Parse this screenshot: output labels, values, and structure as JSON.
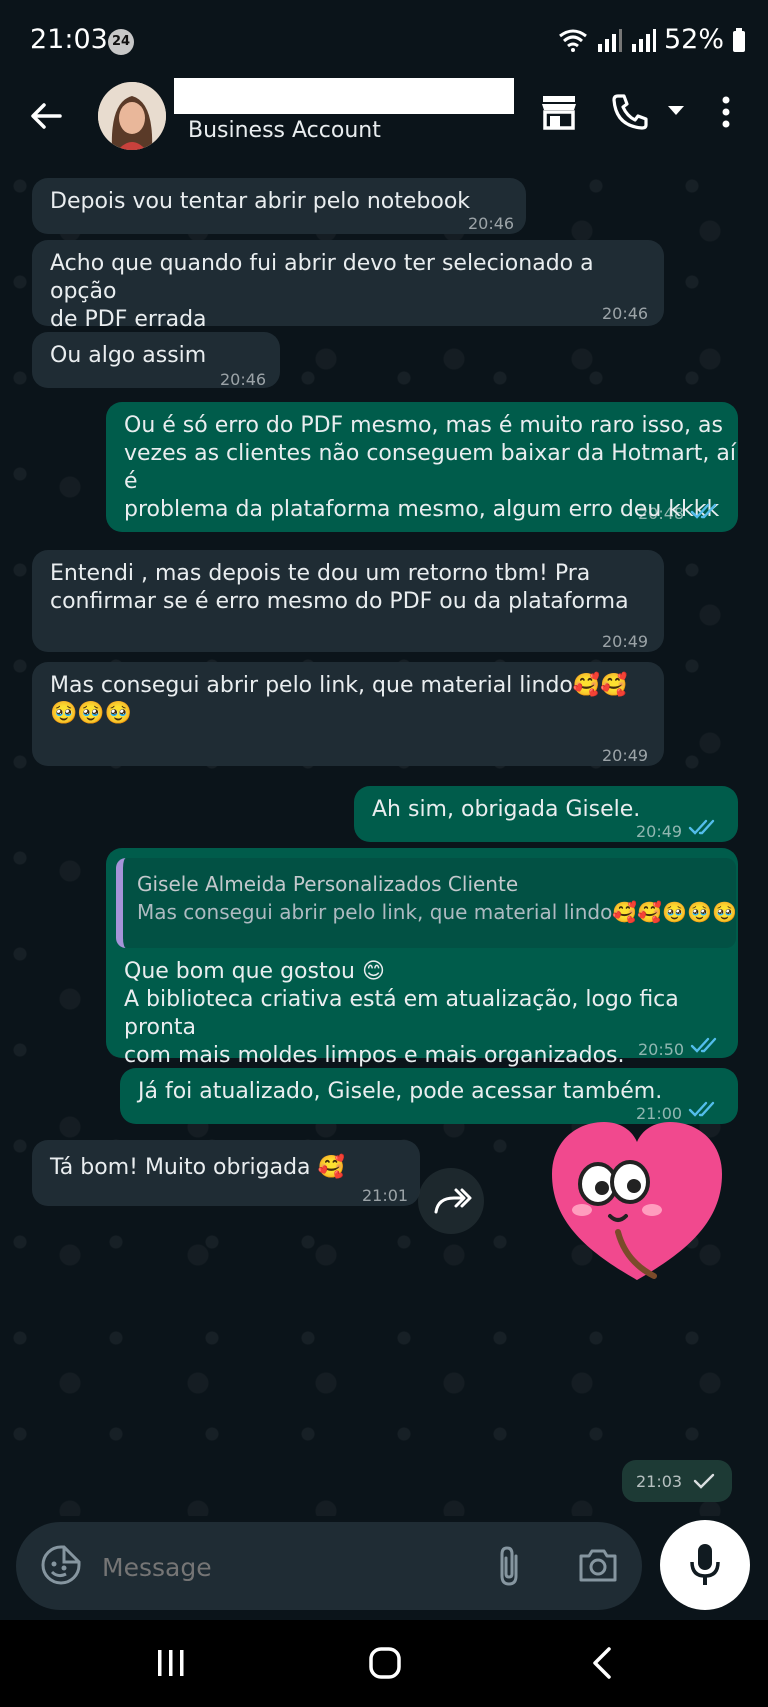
{
  "status_bar": {
    "time": "21:03",
    "notification_count": "24",
    "battery": "52%"
  },
  "header": {
    "subtitle": "Business Account"
  },
  "messages": [
    {
      "dir": "in",
      "text": "Depois vou tentar abrir pelo notebook",
      "time": "20:46"
    },
    {
      "dir": "in",
      "text": "Acho que quando fui abrir devo ter selecionado a opção\nde PDF errada",
      "time": "20:46"
    },
    {
      "dir": "in",
      "text": "Ou algo assim",
      "time": "20:46"
    },
    {
      "dir": "out",
      "text": "Ou é só erro do PDF mesmo, mas é muito raro isso, as\nvezes as clientes não conseguem baixar da Hotmart, aí é\nproblema da plataforma mesmo, algum erro deu kkkk",
      "time": "20:48",
      "status": "read"
    },
    {
      "dir": "in",
      "text": "Entendi , mas depois te dou um retorno tbm! Pra\nconfirmar se é erro mesmo do PDF ou da plataforma",
      "time": "20:49"
    },
    {
      "dir": "in",
      "text": "Mas consegui abrir pelo link, que material lindo🥰🥰\n🥹🥹🥹",
      "time": "20:49"
    },
    {
      "dir": "out",
      "text": "Ah sim, obrigada Gisele.",
      "time": "20:49",
      "status": "read"
    },
    {
      "dir": "out",
      "reply_to_name": "Gisele Almeida Personalizados Cliente",
      "reply_to_text": "Mas consegui abrir pelo link, que material lindo🥰🥰🥹🥹🥹",
      "text": "Que bom que gostou 😊\nA biblioteca criativa está em atualização, logo fica pronta\ncom mais moldes limpos e mais organizados.",
      "time": "20:50",
      "status": "read"
    },
    {
      "dir": "out",
      "text": "Já foi atualizado, Gisele, pode acessar também.",
      "time": "21:00",
      "status": "read"
    },
    {
      "dir": "in",
      "text": "Tá bom! Muito obrigada 🥰",
      "time": "21:01"
    }
  ],
  "sticker_message": {
    "time": "21:03",
    "status": "sent"
  },
  "composer": {
    "placeholder": "Message"
  },
  "colors": {
    "incoming": "#1f2c34",
    "outgoing": "#005c4b",
    "read_ticks": "#53bdeb",
    "background": "#0b141a"
  },
  "icons": [
    "back-arrow-icon",
    "store-icon",
    "phone-icon",
    "chevron-down-icon",
    "more-vert-icon",
    "forward-icon",
    "sticker-icon",
    "attach-icon",
    "camera-icon",
    "mic-icon",
    "recents-icon",
    "home-icon",
    "nav-back-icon"
  ]
}
